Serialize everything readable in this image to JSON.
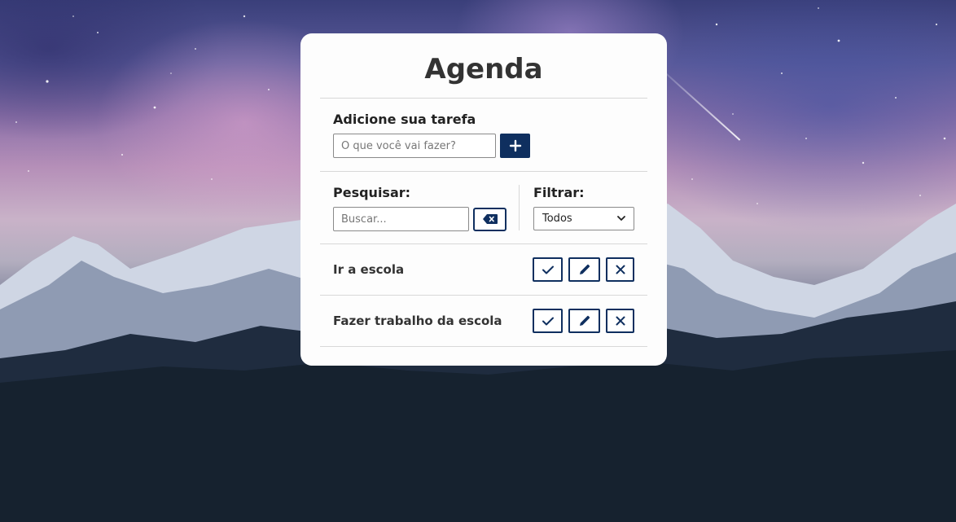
{
  "app": {
    "title": "Agenda"
  },
  "add": {
    "label": "Adicione sua tarefa",
    "placeholder": "O que você vai fazer?",
    "value": "",
    "button_icon": "plus-icon"
  },
  "search": {
    "label": "Pesquisar:",
    "placeholder": "Buscar...",
    "value": "",
    "clear_icon": "backspace-icon"
  },
  "filter": {
    "label": "Filtrar:",
    "selected": "Todos",
    "icon": "chevron-down-icon"
  },
  "todos": [
    {
      "text": "Ir a escola",
      "icons": [
        "check-icon",
        "pencil-icon",
        "close-icon"
      ]
    },
    {
      "text": "Fazer trabalho da escola",
      "icons": [
        "check-icon",
        "pencil-icon",
        "close-icon"
      ]
    }
  ],
  "colors": {
    "accent": "#0f2f5f",
    "card": "#fdfdfd",
    "text": "#333333"
  }
}
